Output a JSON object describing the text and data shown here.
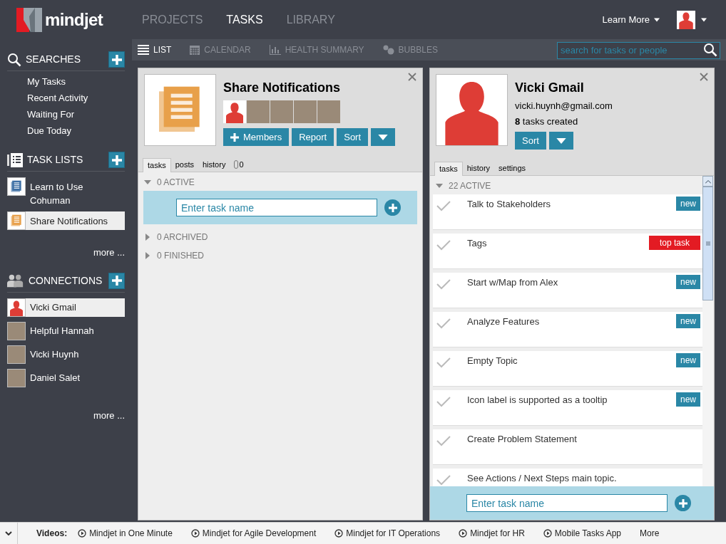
{
  "header": {
    "logo": "mindjet",
    "nav": [
      {
        "label": "PROJECTS",
        "selected": false
      },
      {
        "label": "TASKS",
        "selected": true
      },
      {
        "label": "LIBRARY",
        "selected": false
      }
    ],
    "learn_more": "Learn More"
  },
  "views": [
    {
      "label": "LIST",
      "selected": true
    },
    {
      "label": "CALENDAR",
      "selected": false
    },
    {
      "label": "HEALTH SUMMARY",
      "selected": false
    },
    {
      "label": "BUBBLES",
      "selected": false
    }
  ],
  "search": {
    "placeholder": "search for tasks or people"
  },
  "sidebar": {
    "searches": {
      "title": "SEARCHES",
      "items": [
        "My Tasks",
        "Recent Activity",
        "Waiting For",
        "Due Today"
      ]
    },
    "task_lists": {
      "title": "TASK LISTS",
      "items": [
        {
          "label": "Learn to Use Cohuman",
          "color": "#3d6fa5",
          "selected": false
        },
        {
          "label": "Share Notifications",
          "color": "#e8a04a",
          "selected": true
        }
      ],
      "more": "more ..."
    },
    "connections": {
      "title": "CONNECTIONS",
      "items": [
        {
          "label": "Vicki Gmail",
          "kind": "silhouette",
          "selected": true
        },
        {
          "label": "Helpful Hannah",
          "kind": "photo",
          "selected": false
        },
        {
          "label": "Vicki Huynh",
          "kind": "photo",
          "selected": false
        },
        {
          "label": "Daniel Salet",
          "kind": "photo",
          "selected": false
        }
      ],
      "more": "more ..."
    }
  },
  "list_panel": {
    "title": "Share Notifications",
    "members": [
      {
        "kind": "silhouette"
      },
      {
        "kind": "photo"
      },
      {
        "kind": "photo"
      },
      {
        "kind": "photo"
      },
      {
        "kind": "photo"
      }
    ],
    "buttons": [
      "Members",
      "Report",
      "Sort"
    ],
    "tabs": [
      {
        "label": "tasks",
        "selected": true
      },
      {
        "label": "posts",
        "selected": false
      },
      {
        "label": "history",
        "selected": false
      }
    ],
    "attachments": "0",
    "sections": [
      {
        "label": "0 ACTIVE",
        "expanded": true
      },
      {
        "label": "0 ARCHIVED",
        "expanded": false
      },
      {
        "label": "0 FINISHED",
        "expanded": false
      }
    ],
    "placeholder": "Enter task name"
  },
  "person_panel": {
    "name": "Vicki Gmail",
    "email": "vicki.huynh@gmail.com",
    "tasks_count": "8",
    "tasks_text": "tasks created",
    "buttons": [
      "Sort"
    ],
    "tabs": [
      {
        "label": "tasks",
        "selected": true
      },
      {
        "label": "history",
        "selected": false
      },
      {
        "label": "settings",
        "selected": false
      }
    ],
    "section": "22 ACTIVE",
    "tasks": [
      {
        "name": "Talk to Stakeholders",
        "tag": "new",
        "kind": "new"
      },
      {
        "name": "Tags",
        "tag": "top task",
        "kind": "top"
      },
      {
        "name": "Start w/Map from Alex",
        "tag": "new",
        "kind": "new"
      },
      {
        "name": "Analyze Features",
        "tag": "new",
        "kind": "new"
      },
      {
        "name": "Empty Topic",
        "tag": "new",
        "kind": "new"
      },
      {
        "name": "Icon label is supported as a tooltip",
        "tag": "new",
        "kind": "new"
      },
      {
        "name": "Create Problem Statement",
        "kind": "none"
      },
      {
        "name": "See Actions / Next Steps main topic.",
        "kind": "none"
      }
    ],
    "placeholder": "Enter task name"
  },
  "footer": {
    "label": "Videos:",
    "videos": [
      "Mindjet in One Minute",
      "Mindjet for Agile Development",
      "Mindjet for IT Operations",
      "Mindjet for HR",
      "Mobile Tasks App"
    ],
    "more": "More"
  }
}
